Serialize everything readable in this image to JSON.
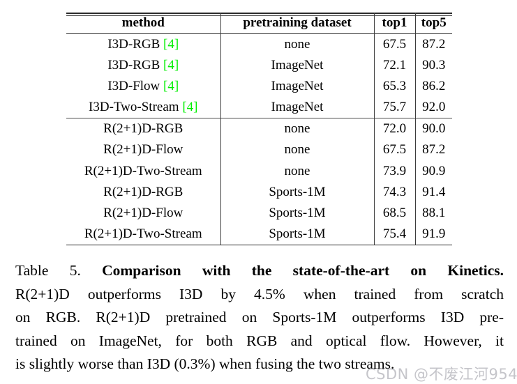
{
  "table": {
    "columns": [
      "method",
      "pretraining dataset",
      "top1",
      "top5"
    ],
    "groups": [
      {
        "rows": [
          {
            "method": "I3D-RGB",
            "citation": "[4]",
            "dataset": "none",
            "top1": "67.5",
            "top5": "87.2",
            "bold_top1": false,
            "bold_top5": false
          },
          {
            "method": "I3D-RGB",
            "citation": "[4]",
            "dataset": "ImageNet",
            "top1": "72.1",
            "top5": "90.3",
            "bold_top1": false,
            "bold_top5": false
          },
          {
            "method": "I3D-Flow",
            "citation": "[4]",
            "dataset": "ImageNet",
            "top1": "65.3",
            "top5": "86.2",
            "bold_top1": false,
            "bold_top5": false
          },
          {
            "method": "I3D-Two-Stream",
            "citation": "[4]",
            "dataset": "ImageNet",
            "top1": "75.7",
            "top5": "92.0",
            "bold_top1": true,
            "bold_top5": true
          }
        ]
      },
      {
        "rows": [
          {
            "method": "R(2+1)D-RGB",
            "citation": "",
            "dataset": "none",
            "top1": "72.0",
            "top5": "90.0",
            "bold_top1": false,
            "bold_top5": false
          },
          {
            "method": "R(2+1)D-Flow",
            "citation": "",
            "dataset": "none",
            "top1": "67.5",
            "top5": "87.2",
            "bold_top1": false,
            "bold_top5": false
          },
          {
            "method": "R(2+1)D-Two-Stream",
            "citation": "",
            "dataset": "none",
            "top1": "73.9",
            "top5": "90.9",
            "bold_top1": false,
            "bold_top5": false
          },
          {
            "method": "R(2+1)D-RGB",
            "citation": "",
            "dataset": "Sports-1M",
            "top1": "74.3",
            "top5": "91.4",
            "bold_top1": false,
            "bold_top5": false
          },
          {
            "method": "R(2+1)D-Flow",
            "citation": "",
            "dataset": "Sports-1M",
            "top1": "68.5",
            "top5": "88.1",
            "bold_top1": false,
            "bold_top5": false
          },
          {
            "method": "R(2+1)D-Two-Stream",
            "citation": "",
            "dataset": "Sports-1M",
            "top1": "75.4",
            "top5": "91.9",
            "bold_top1": true,
            "bold_top5": true
          }
        ]
      }
    ]
  },
  "caption": {
    "label": "Table 5.",
    "bold_title": "Comparison with the state-of-the-art on Kinetics",
    "period": ".",
    "line2": "R(2+1)D outperforms I3D by 4.5% when trained from scratch",
    "line3": "on RGB. R(2+1)D pretrained on Sports-1M outperforms I3D pre-",
    "line4": "trained on ImageNet, for both RGB and optical flow.  However, it",
    "line5": "is slightly worse than I3D (0.3%) when fusing the two streams."
  },
  "watermark": {
    "text": "CSDN @不废江河954"
  },
  "colors": {
    "citation_green": "#00ee00",
    "rule": "#2b2b2b",
    "text": "#000000",
    "background": "#ffffff",
    "watermark": "#96969e"
  }
}
